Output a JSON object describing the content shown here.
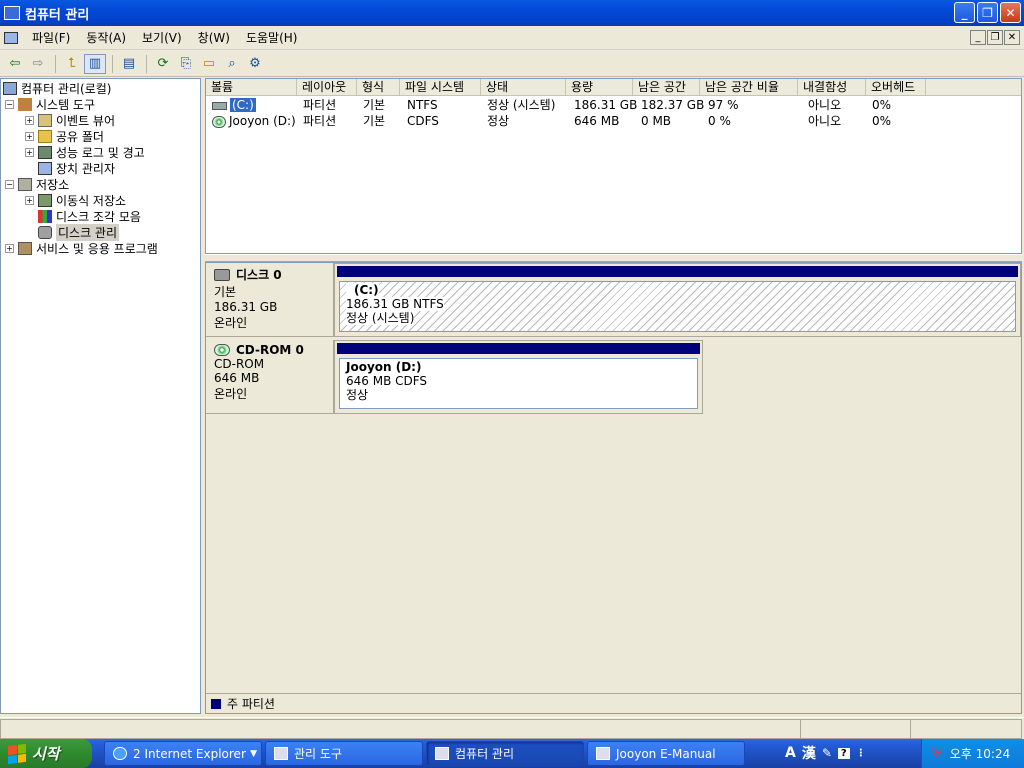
{
  "window": {
    "title": "컴퓨터 관리"
  },
  "menu": {
    "items": [
      "파일(F)",
      "동작(A)",
      "보기(V)",
      "창(W)",
      "도움말(H)"
    ]
  },
  "toolbar": {
    "icons": [
      "back-icon",
      "forward-icon",
      "up-folder-icon",
      "show-tree-icon",
      "properties-icon",
      "refresh-icon",
      "export-icon",
      "open-icon",
      "find-icon",
      "settings-icon"
    ]
  },
  "tree": {
    "root": "컴퓨터 관리(로컬)",
    "system_tools": "시스템 도구",
    "event_viewer": "이벤트 뷰어",
    "shared_folders": "공유 폴더",
    "perf_logs": "성능 로그 및 경고",
    "device_manager": "장치 관리자",
    "storage": "저장소",
    "removable_storage": "이동식 저장소",
    "defrag": "디스크 조각 모음",
    "disk_mgmt": "디스크 관리",
    "services": "서비스 및 응용 프로그램"
  },
  "volumes": {
    "columns": [
      "볼륨",
      "레이아웃",
      "형식",
      "파일 시스템",
      "상태",
      "용량",
      "남은 공간",
      "남은 공간 비율",
      "내결함성",
      "오버헤드"
    ],
    "rows": [
      {
        "volume": "(C:)",
        "layout": "파티션",
        "type": "기본",
        "fs": "NTFS",
        "status": "정상 (시스템)",
        "capacity": "186.31 GB",
        "free": "182.37 GB",
        "free_pct": "97 %",
        "fault": "아니오",
        "overhead": "0%"
      },
      {
        "volume": "Jooyon (D:)",
        "layout": "파티션",
        "type": "기본",
        "fs": "CDFS",
        "status": "정상",
        "capacity": "646 MB",
        "free": "0 MB",
        "free_pct": "0 %",
        "fault": "아니오",
        "overhead": "0%"
      }
    ]
  },
  "disks": [
    {
      "name": "디스크 0",
      "kind": "기본",
      "size": "186.31 GB",
      "state": "온라인",
      "part_name": "(C:)",
      "part_size": "186.31 GB NTFS",
      "part_status": "정상 (시스템)"
    },
    {
      "name": "CD-ROM 0",
      "kind": "CD-ROM",
      "size": "646 MB",
      "state": "온라인",
      "part_name": "Jooyon  (D:)",
      "part_size": "646 MB CDFS",
      "part_status": "정상"
    }
  ],
  "legend": {
    "primary": "주 파티션",
    "color": "#00007b"
  },
  "taskbar": {
    "start": "시작",
    "buttons": [
      "2 Internet Explorer",
      "관리 도구",
      "컴퓨터 관리",
      "Jooyon E-Manual"
    ],
    "lang_a": "A",
    "lang_han": "漢",
    "clock": "오후 10:24"
  }
}
